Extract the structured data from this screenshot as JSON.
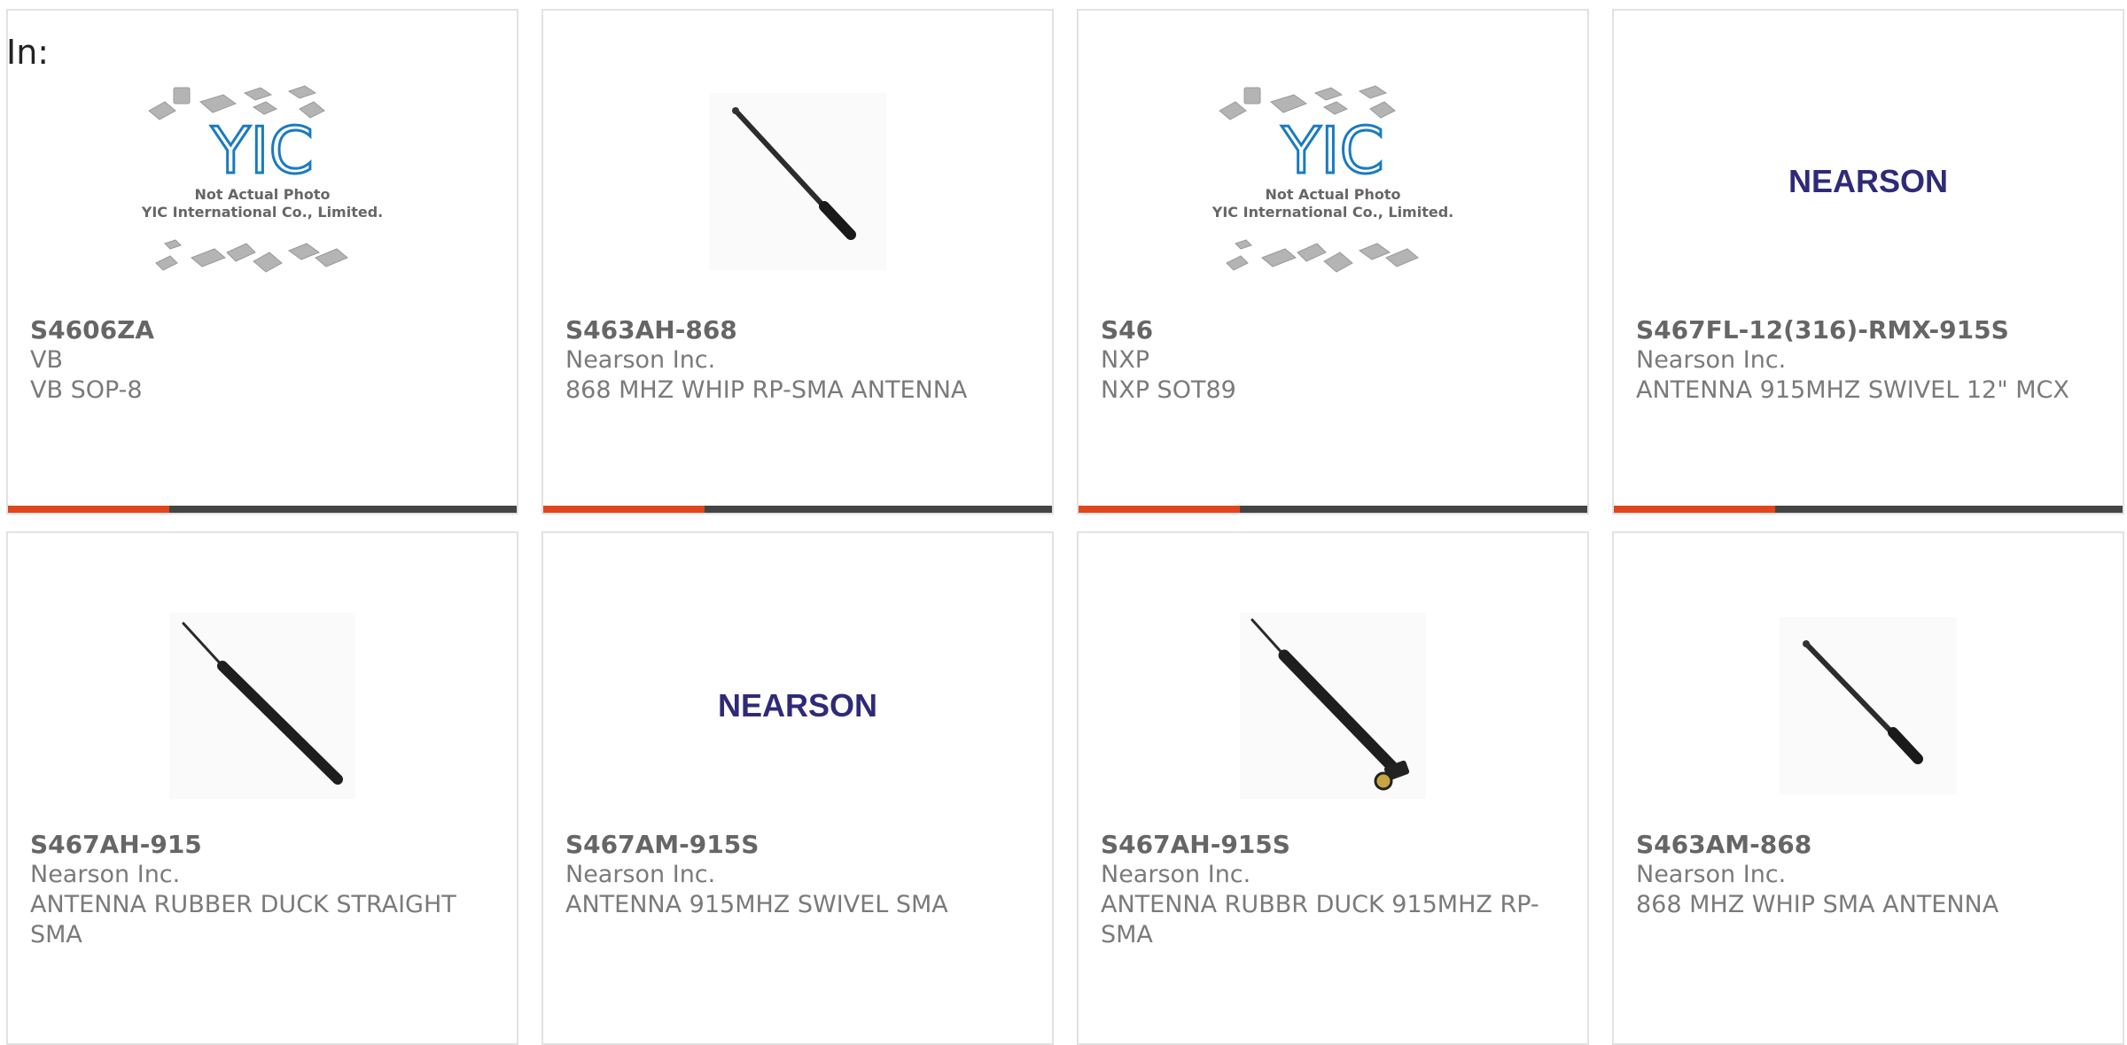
{
  "filter": {
    "label": "In:"
  },
  "placeholder": {
    "line1": "Not Actual Photo",
    "line2": "YIC International Co., Limited.",
    "logo": "YIC"
  },
  "brand_logo_text": "NEARSON",
  "colors": {
    "accent": "#e0461c",
    "bar": "#444444",
    "nearson": "#2f2a78",
    "yic": "#1a7bbf"
  },
  "products": [
    {
      "part": "S4606ZA",
      "manufacturer": "VB",
      "description": "VB SOP-8",
      "image": "placeholder"
    },
    {
      "part": "S463AH-868",
      "manufacturer": "Nearson Inc.",
      "description": "868 MHZ WHIP RP-SMA ANTENNA",
      "image": "antenna-whip"
    },
    {
      "part": "S46",
      "manufacturer": "NXP",
      "description": "NXP SOT89",
      "image": "placeholder"
    },
    {
      "part": "S467FL-12(316)-RMX-915S",
      "manufacturer": "Nearson Inc.",
      "description": "ANTENNA 915MHZ SWIVEL 12\" MCX",
      "image": "nearson-logo"
    },
    {
      "part": "S467AH-915",
      "manufacturer": "Nearson Inc.",
      "description": "ANTENNA RUBBER DUCK STRAIGHT SMA",
      "image": "antenna-duck"
    },
    {
      "part": "S467AM-915S",
      "manufacturer": "Nearson Inc.",
      "description": "ANTENNA 915MHZ SWIVEL SMA",
      "image": "nearson-logo"
    },
    {
      "part": "S467AH-915S",
      "manufacturer": "Nearson Inc.",
      "description": "ANTENNA RUBBR DUCK 915MHZ RP-SMA",
      "image": "antenna-swivel"
    },
    {
      "part": "S463AM-868",
      "manufacturer": "Nearson Inc.",
      "description": "868 MHZ WHIP SMA ANTENNA",
      "image": "antenna-whip"
    }
  ]
}
